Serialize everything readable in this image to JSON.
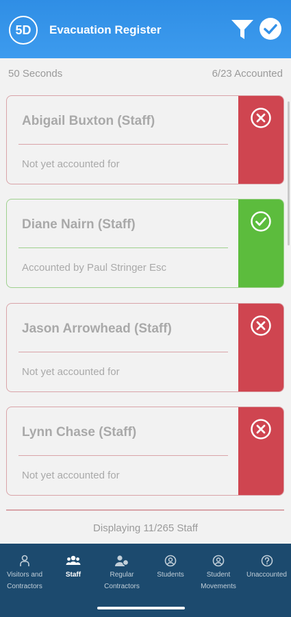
{
  "header": {
    "logo_text": "5D",
    "title": "Evacuation Register"
  },
  "info": {
    "timer": "50 Seconds",
    "accounted": "6/23 Accounted"
  },
  "people": [
    {
      "name": "Abigail Buxton (Staff)",
      "status": "Not yet accounted for",
      "state": "unaccounted"
    },
    {
      "name": "Diane Nairn (Staff)",
      "status": "Accounted by Paul Stringer Esc",
      "state": "accounted"
    },
    {
      "name": "Jason Arrowhead (Staff)",
      "status": "Not yet accounted for",
      "state": "unaccounted"
    },
    {
      "name": "Lynn Chase (Staff)",
      "status": "Not yet accounted for",
      "state": "unaccounted"
    }
  ],
  "footer": {
    "displaying": "Displaying 11/265 Staff"
  },
  "nav": [
    {
      "line1": "Visitors and",
      "line2": "Contractors",
      "icon": "person-icon"
    },
    {
      "line1": "Staff",
      "line2": "",
      "icon": "group-icon",
      "active": true
    },
    {
      "line1": "Regular",
      "line2": "Contractors",
      "icon": "contractor-icon"
    },
    {
      "line1": "Students",
      "line2": "",
      "icon": "student-icon"
    },
    {
      "line1": "Student",
      "line2": "Movements",
      "icon": "movement-icon"
    },
    {
      "line1": "Unaccounted",
      "line2": "",
      "icon": "question-icon"
    }
  ],
  "colors": {
    "header": "#3391e8",
    "red": "#cf4550",
    "green": "#5cbc3d",
    "nav": "#1c4a6e"
  }
}
